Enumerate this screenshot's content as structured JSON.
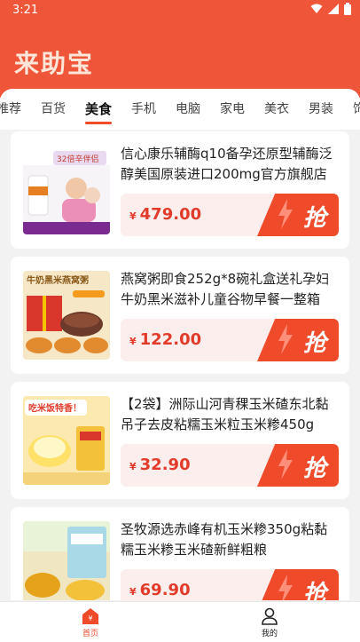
{
  "status": {
    "time": "3:21"
  },
  "app": {
    "title": "来助宝"
  },
  "tabs": [
    {
      "label": "推荐"
    },
    {
      "label": "百货"
    },
    {
      "label": "美食"
    },
    {
      "label": "手机"
    },
    {
      "label": "电脑"
    },
    {
      "label": "家电"
    },
    {
      "label": "美衣"
    },
    {
      "label": "男装"
    },
    {
      "label": "饰品"
    }
  ],
  "active_tab": "美食",
  "products": [
    {
      "title": "信心康乐辅酶q10备孕还原型辅酶泛醇美国原装进口200mg官方旗舰店",
      "currency": "¥",
      "price": "479.00",
      "action": "抢",
      "image_text": "32倍辛伴侣"
    },
    {
      "title": "燕窝粥即食252g*8碗礼盒送礼孕妇牛奶黑米滋补儿童谷物早餐一整箱",
      "currency": "¥",
      "price": "122.00",
      "action": "抢",
      "image_text": "牛奶黑米燕窝粥"
    },
    {
      "title": "【2袋】洲际山河青稞玉米碴东北黏吊子去皮粘糯玉米粒玉米糁450g",
      "currency": "¥",
      "price": "32.90",
      "action": "抢",
      "image_text": "吃米饭特香！"
    },
    {
      "title": "圣牧源选赤峰有机玉米糁350g粘黏糯玉米糁玉米碴新鲜粗粮",
      "currency": "¥",
      "price": "69.90",
      "action": "抢",
      "image_text": ""
    }
  ],
  "bottom_nav": {
    "home": "首页",
    "mine": "我的"
  },
  "colors": {
    "brand": "#ef5538",
    "accent": "#ef4a2a",
    "price_bg": "#fdeeee"
  }
}
